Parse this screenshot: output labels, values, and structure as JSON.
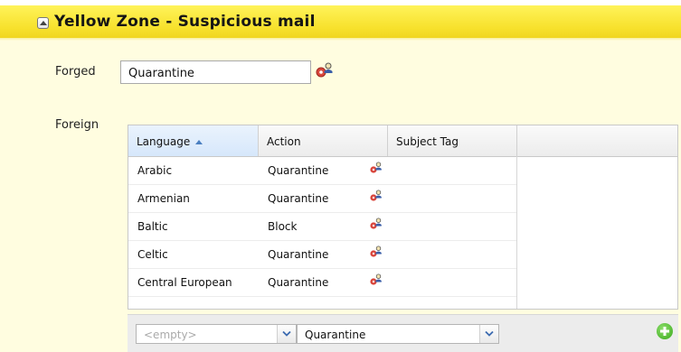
{
  "panel": {
    "title": "Yellow Zone - Suspicious mail"
  },
  "forged": {
    "label": "Forged",
    "value": "Quarantine"
  },
  "foreign": {
    "label": "Foreign",
    "columns": [
      "Language",
      "Action",
      "Subject Tag"
    ],
    "sorted_column": "Language",
    "sort_direction": "ascending",
    "rows": [
      {
        "language": "Arabic",
        "action": "Quarantine",
        "subject_tag": ""
      },
      {
        "language": "Armenian",
        "action": "Quarantine",
        "subject_tag": ""
      },
      {
        "language": "Baltic",
        "action": "Block",
        "subject_tag": ""
      },
      {
        "language": "Celtic",
        "action": "Quarantine",
        "subject_tag": ""
      },
      {
        "language": "Central European",
        "action": "Quarantine",
        "subject_tag": ""
      }
    ]
  },
  "editor": {
    "language_placeholder": "<empty>",
    "action_value": "Quarantine"
  },
  "colors": {
    "zone_yellow": "#f7e12c",
    "background": "#fffde0",
    "add_green": "#37a818"
  },
  "icons": [
    "collapse-icon",
    "settings-gear-icon",
    "add-icon",
    "chevron-down-icon"
  ]
}
